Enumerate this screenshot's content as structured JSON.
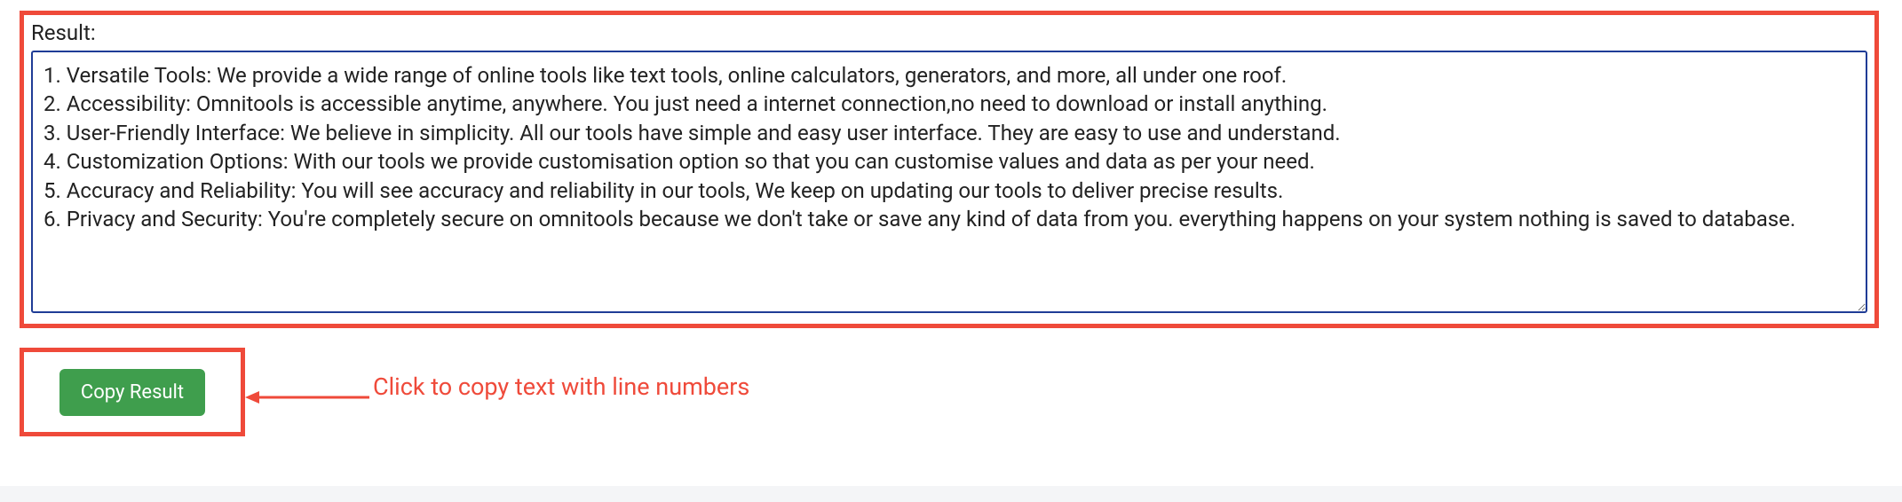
{
  "result": {
    "label": "Result:",
    "text": "1. Versatile Tools: We provide a wide range of online tools like text tools, online calculators, generators, and more, all under one roof.\n2. Accessibility: Omnitools is accessible anytime, anywhere. You just need a internet connection,no need to download or install anything.\n3. User-Friendly Interface: We believe in simplicity. All our tools have simple and easy user interface. They are easy to use and understand.\n4. Customization Options: With our tools we provide customisation option so that you can customise values and data as per your need.\n5. Accuracy and Reliability: You will see accuracy and reliability in our tools, We keep on updating our tools to deliver precise results.\n6. Privacy and Security: You're completely secure on omnitools because we don't take or save any kind of data from you. everything happens on your system nothing is saved to database."
  },
  "actions": {
    "copy_label": "Copy Result"
  },
  "annotation": {
    "text": "Click to copy text with line numbers"
  },
  "colors": {
    "highlight_border": "#ef4a3a",
    "textarea_border": "#1f3c96",
    "button_bg": "#3f9e4d"
  }
}
